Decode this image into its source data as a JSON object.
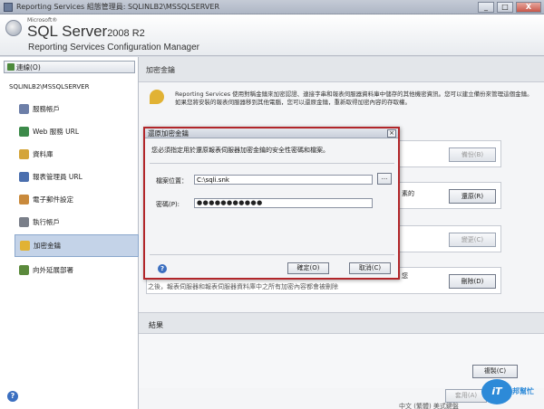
{
  "window": {
    "title": "Reporting Services 組態管理員: SQLINLB2\\MSSQLSERVER",
    "minimize": "_",
    "maximize": "□",
    "close": "X"
  },
  "brand": {
    "ms": "Microsoft®",
    "sql": "SQL Server",
    "version": "2008 R2",
    "product": "Reporting Services Configuration Manager"
  },
  "nav": {
    "connect": "連線(O)",
    "server": "SQLINLB2\\MSSQLSERVER",
    "items": [
      {
        "label": "服務帳戶",
        "color": "#6d7fa8"
      },
      {
        "label": "Web 服務 URL",
        "color": "#3c8a4a"
      },
      {
        "label": "資料庫",
        "color": "#d4a53a"
      },
      {
        "label": "報表管理員 URL",
        "color": "#4b6fae"
      },
      {
        "label": "電子郵件設定",
        "color": "#c98a3c"
      },
      {
        "label": "執行帳戶",
        "color": "#7a7f89"
      },
      {
        "label": "加密金鑰",
        "color": "#e1b234"
      },
      {
        "label": "向外延展部署",
        "color": "#5b8a3c"
      }
    ]
  },
  "content": {
    "section_title": "加密金鑰",
    "description": "Reporting Services 使用對稱金鑰來加密認證、連接字串和報表伺服器資料庫中儲存的其他機密資訊。您可以建立備份來管理這個金鑰。如果您將安裝的報表伺服器移到其他電腦，您可以還原金鑰，重新取得加密內容的存取權。",
    "backup_label": "備份(B)",
    "restore_label": "還原(R)",
    "restore_partial": "素的",
    "change_label": "變更(C)",
    "delete_label": "刪除(D)",
    "delete_partial_1": "您",
    "delete_partial_2": "之後，報表伺服器和報表伺服器資料庫中之所有加密內容都會被刪除",
    "results_title": "結果",
    "copy_label": "複製(C)",
    "apply_label": "套用(A)",
    "status_text": "中文 (繁體)   美式鍵盤"
  },
  "dialog": {
    "title": "還原加密金鑰",
    "close": "×",
    "message": "您必須指定用於還原報表伺服器加密金鑰的安全性密碼和檔案。",
    "file_label": "檔案位置：",
    "file_value": "C:\\sqli.snk",
    "browse": "...",
    "password_label": "密碼(P):",
    "password_value": "●●●●●●●●●●●",
    "help": "?",
    "ok_label": "確定(O)",
    "cancel_label": "取消(C)"
  },
  "watermark": {
    "a": "iT",
    "b": "邦幫忙"
  },
  "colors": {
    "dialog_border": "#b2262a",
    "nav_active": "#c4d3e8",
    "accent_blue": "#3b6fc0"
  }
}
